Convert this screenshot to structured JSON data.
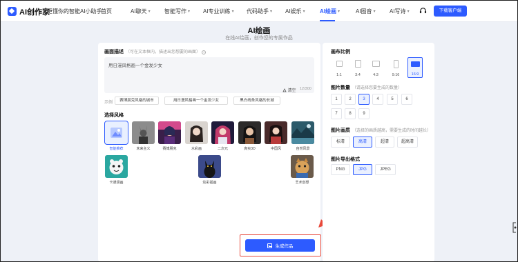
{
  "header": {
    "logo_text": "AI创作家",
    "slogan": "更懂你的智能AI小助手",
    "nav": [
      {
        "label": "首页",
        "has_caret": false
      },
      {
        "label": "AI聊天",
        "has_caret": true
      },
      {
        "label": "智能写作",
        "has_caret": true
      },
      {
        "label": "AI专业训练",
        "has_caret": true
      },
      {
        "label": "代码助手",
        "has_caret": true
      },
      {
        "label": "AI娱乐",
        "has_caret": true
      },
      {
        "label": "AI绘画",
        "has_caret": true,
        "active": true
      },
      {
        "label": "AI图音",
        "has_caret": true
      },
      {
        "label": "AI写诗",
        "has_caret": true
      }
    ],
    "download_label": "下载客户端"
  },
  "hero": {
    "title": "AI绘画",
    "subtitle": "在线AI绘画，创作您的专属作品"
  },
  "description": {
    "title": "画面描述",
    "hint": "（可在文本框内，描述出您想要的画面）",
    "value": "用日漫风格画一个金发少女",
    "clear_label": "清空",
    "counter": "12/300",
    "example_label": "示例",
    "examples": [
      "赛博朋克风格的城市",
      "用日漫风格画一个金发少女",
      "黑白线条风格的长城"
    ]
  },
  "style": {
    "title": "选择风格",
    "items": [
      {
        "label": "智能推荐",
        "selected": true
      },
      {
        "label": "未来主义"
      },
      {
        "label": "赛博朋克"
      },
      {
        "label": "水彩画"
      },
      {
        "label": "二次元"
      },
      {
        "label": "真实3D"
      },
      {
        "label": "中国风"
      },
      {
        "label": "自然风景"
      },
      {
        "label": "卡通漫画"
      },
      {
        "label": "炫彩插画"
      },
      {
        "label": "艺术创想"
      }
    ]
  },
  "generate": {
    "label": "生成作品"
  },
  "ratio": {
    "title": "画布比例",
    "options": [
      {
        "label": "1:1"
      },
      {
        "label": "3:4"
      },
      {
        "label": "4:3"
      },
      {
        "label": "9:16"
      },
      {
        "label": "16:9",
        "selected": true
      }
    ]
  },
  "count": {
    "title": "图片数量",
    "hint": "（请选择您要生成的数量）",
    "options": [
      "1",
      "2",
      "3",
      "4",
      "5",
      "6",
      "7",
      "8",
      "9"
    ],
    "selected": "3"
  },
  "quality": {
    "title": "图片画质",
    "hint": "（选择的画质越高，需要生成的时间越长）",
    "options": [
      "标清",
      "高清",
      "超清",
      "超高清"
    ],
    "selected": "高清"
  },
  "format": {
    "title": "图片导出格式",
    "options": [
      "PNG",
      "JPG",
      "JPEG"
    ],
    "selected": "JPG"
  },
  "colors": {
    "primary": "#2d5bff",
    "highlight_border": "#e8493b",
    "annotation_arrow": "#e8493b"
  }
}
